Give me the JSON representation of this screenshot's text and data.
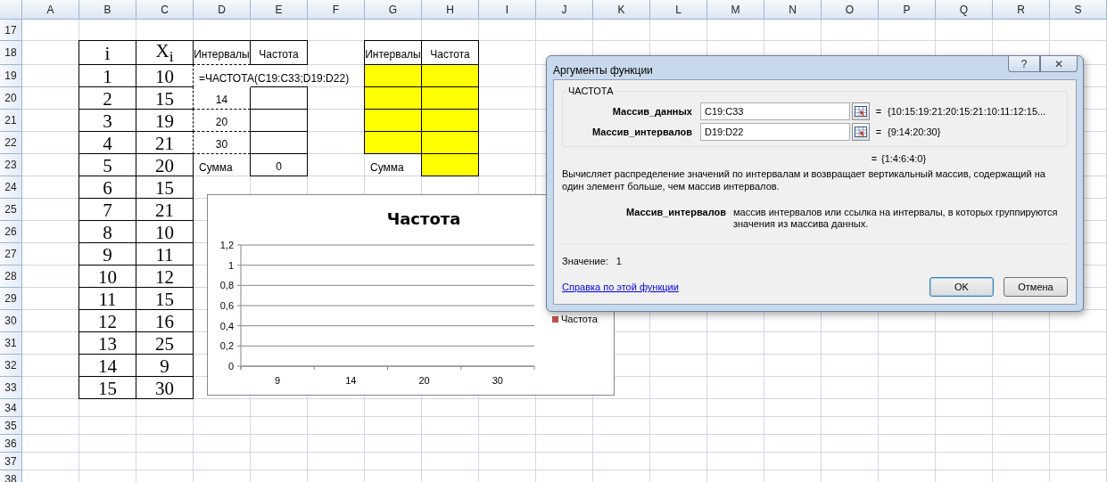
{
  "sheet": {
    "columns": [
      "A",
      "B",
      "C",
      "D",
      "E",
      "F",
      "G",
      "H",
      "I",
      "J",
      "K",
      "L",
      "M",
      "N",
      "O",
      "P",
      "Q",
      "R",
      "S"
    ],
    "rows": [
      "17",
      "18",
      "19",
      "20",
      "21",
      "22",
      "23",
      "24",
      "25",
      "26",
      "27",
      "28",
      "29",
      "30",
      "31",
      "32",
      "33",
      "34",
      "35",
      "36",
      "37",
      "38"
    ]
  },
  "values_table": {
    "columns": [
      "i",
      "X$_{i}$"
    ],
    "rows": [
      [
        "1",
        "10"
      ],
      [
        "2",
        "15"
      ],
      [
        "3",
        "19"
      ],
      [
        "4",
        "21"
      ],
      [
        "5",
        "20"
      ],
      [
        "6",
        "15"
      ],
      [
        "7",
        "21"
      ],
      [
        "8",
        "10"
      ],
      [
        "9",
        "11"
      ],
      [
        "10",
        "12"
      ],
      [
        "11",
        "15"
      ],
      [
        "12",
        "16"
      ],
      [
        "13",
        "25"
      ],
      [
        "14",
        "9"
      ],
      [
        "15",
        "30"
      ]
    ]
  },
  "frequency_table": {
    "columns": [
      "Интервалы",
      "Частота"
    ],
    "formula": "=ЧАСТОТА(C19:C33;D19:D22)",
    "intervals": [
      "14",
      "20",
      "30"
    ],
    "sum_label": "Сумма",
    "sum": "0"
  },
  "answer_table": {
    "columns": [
      "Интервалы",
      "Частота"
    ],
    "rows": [
      {
        "highlighted": true
      },
      {
        "highlighted": true
      },
      {
        "highlighted": true
      },
      {
        "highlighted": true
      }
    ],
    "sum_label": "Сумма",
    "sum_highlighted": true
  },
  "chart": {
    "chart_data": {
      "type": "bar",
      "title": "Частота",
      "categories": [
        "9",
        "14",
        "20",
        "30"
      ],
      "series": [
        {
          "name": "Частота",
          "color": "#c0504d",
          "values": [
            null,
            null,
            null,
            null
          ]
        }
      ],
      "ylim": [
        0,
        1.2
      ],
      "grid": true,
      "legend": true,
      "yticks": [
        {
          "value": 0,
          "label": "0"
        },
        {
          "value": 0.2,
          "label": "0,2"
        },
        {
          "value": 0.4,
          "label": "0,4"
        },
        {
          "value": 0.6,
          "label": "0,6"
        },
        {
          "value": 0.8,
          "label": "0,8"
        },
        {
          "value": 1,
          "label": "1"
        },
        {
          "value": 1.2,
          "label": "1,2"
        }
      ]
    }
  },
  "dialog": {
    "title": "Аргументы функции",
    "title_buttons": [
      "?",
      "✕"
    ],
    "function_name": "ЧАСТОТА",
    "arguments": [
      {
        "label": "Массив_данных",
        "value": "C19:C33",
        "equals": "=",
        "result": "{10:15:19:21:20:15:21:10:11:12:15..."
      },
      {
        "label": "Массив_интервалов",
        "value": "D19:D22",
        "equals": "=",
        "result": "{9:14:20:30}"
      }
    ],
    "formula_equals": "=",
    "formula_result": "{1:4:6:4:0}",
    "description": "Вычисляет распределение значений по интервалам и возвращает вертикальный массив, содержащий на один элемент больше, чем массив интервалов.",
    "argument_help": {
      "label": "Массив_интервалов",
      "text": "массив интервалов или ссылка на интервалы, в которых группируются значения из массива данных."
    },
    "value_label": "Значение:",
    "value": "1",
    "help_link": "Справка по этой функции",
    "buttons": [
      {
        "label": "OK",
        "default": true
      },
      {
        "label": "Отмена",
        "default": false
      }
    ]
  }
}
